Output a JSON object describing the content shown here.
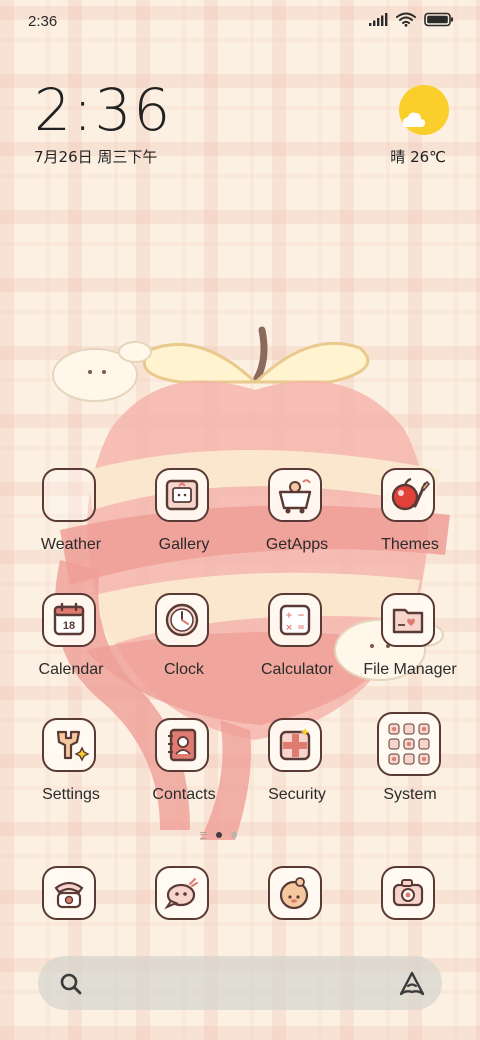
{
  "status_bar": {
    "time": "2:36",
    "icons": [
      "signal-icon",
      "wifi-icon",
      "battery-icon"
    ]
  },
  "clock_widget": {
    "time": "2:36",
    "date": "7月26日 周三下午"
  },
  "weather_widget": {
    "icon": "sun-cloud-icon",
    "text": "晴 26℃"
  },
  "apps": [
    {
      "label": "Weather",
      "icon": "weather-icon"
    },
    {
      "label": "Gallery",
      "icon": "gallery-icon"
    },
    {
      "label": "GetApps",
      "icon": "getapps-icon"
    },
    {
      "label": "Themes",
      "icon": "themes-icon"
    },
    {
      "label": "Calendar",
      "icon": "calendar-icon",
      "icon_text": "18"
    },
    {
      "label": "Clock",
      "icon": "clock-icon"
    },
    {
      "label": "Calculator",
      "icon": "calculator-icon"
    },
    {
      "label": "File Manager",
      "icon": "file-manager-icon"
    },
    {
      "label": "Settings",
      "icon": "settings-icon"
    },
    {
      "label": "Contacts",
      "icon": "contacts-icon"
    },
    {
      "label": "Security",
      "icon": "security-icon"
    },
    {
      "label": "System",
      "icon": "system-folder-icon"
    }
  ],
  "dock": [
    {
      "icon": "phone-icon"
    },
    {
      "icon": "messages-icon"
    },
    {
      "icon": "browser-icon"
    },
    {
      "icon": "camera-icon"
    }
  ],
  "page_indicator": {
    "pages": 2,
    "active": 1
  },
  "search_bar": {
    "search_icon": "search-icon",
    "assistant_icon": "assistant-icon"
  },
  "colors": {
    "background": "#fbf0e2",
    "plaid": "#f0beaf",
    "icon_border": "#5a3a34",
    "apple": "#f2a9a2",
    "accent_red": "#e07b72",
    "sun": "#fbcf2b"
  }
}
